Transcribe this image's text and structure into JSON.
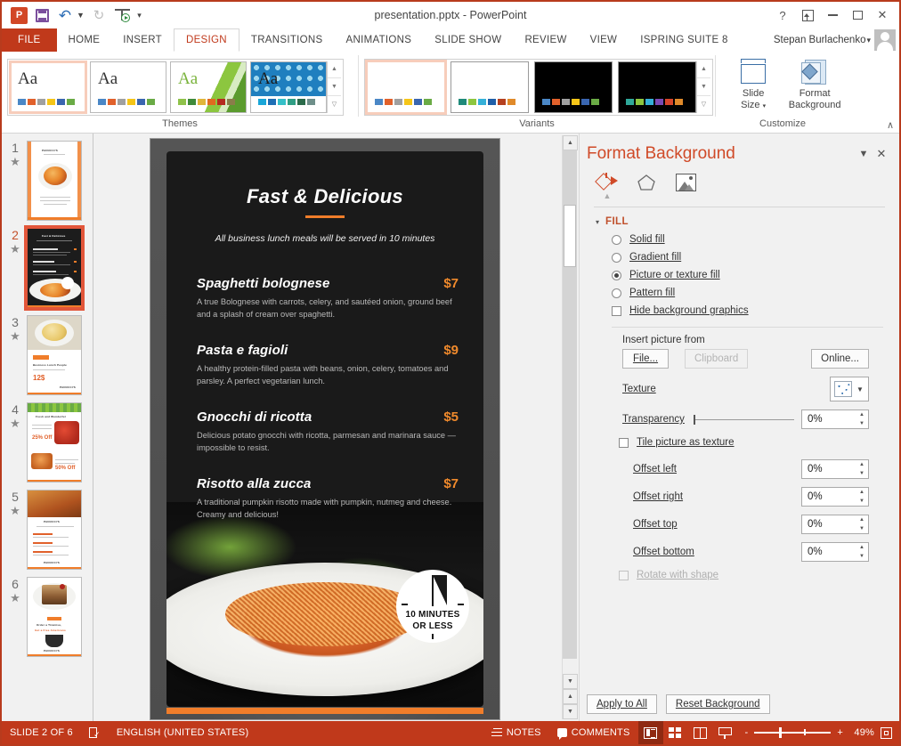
{
  "titlebar": {
    "document_title": "presentation.pptx - PowerPoint",
    "quick_access": [
      {
        "name": "powerpoint-logo",
        "label": "P"
      },
      {
        "name": "save",
        "label": "Save"
      },
      {
        "name": "undo",
        "label": "Undo"
      },
      {
        "name": "redo",
        "label": "Redo"
      },
      {
        "name": "start-slideshow",
        "label": "Start From Beginning"
      },
      {
        "name": "customize-qat",
        "label": "Customize Quick Access Toolbar"
      }
    ],
    "help_label": "?",
    "ribbon_display_label": "Ribbon Display Options",
    "minimize_label": "Minimize",
    "maximize_label": "Restore Down",
    "close_label": "✕"
  },
  "tabs": {
    "file": "FILE",
    "items": [
      "HOME",
      "INSERT",
      "DESIGN",
      "TRANSITIONS",
      "ANIMATIONS",
      "SLIDE SHOW",
      "REVIEW",
      "VIEW",
      "ISPRING SUITE 8"
    ],
    "active": "DESIGN",
    "user_name": "Stepan Burlachenko"
  },
  "ribbon": {
    "groups": [
      {
        "label": "Themes"
      },
      {
        "label": "Variants"
      },
      {
        "label": "Customize"
      }
    ],
    "themes": [
      {
        "name": "theme-office",
        "aa": "Aa",
        "selected": true,
        "swatches": [
          "#4a87c6",
          "#e1612b",
          "#a0a0a0",
          "#f5c518",
          "#3a66b0",
          "#6aab45"
        ]
      },
      {
        "name": "theme-plain",
        "aa": "Aa",
        "selected": false,
        "swatches": [
          "#4a87c6",
          "#e1612b",
          "#a0a0a0",
          "#f5c518",
          "#3a66b0",
          "#6aab45"
        ]
      },
      {
        "name": "theme-facet",
        "aa": "Aa",
        "selected": false,
        "swatches": [
          "#8fc24a",
          "#3f8a3a",
          "#e0b53a",
          "#e06a1f",
          "#b52a1f",
          "#8a7d4a"
        ]
      },
      {
        "name": "theme-ion-boardroom",
        "aa": "Aa",
        "selected": false,
        "swatches": [
          "#19a6d8",
          "#1f6fb5",
          "#35c0c8",
          "#2f9e84",
          "#2b6b4a",
          "#6e8f8a"
        ]
      }
    ],
    "variants": [
      {
        "name": "variant-1",
        "bg": "#ffffff",
        "selected": true,
        "swatches": [
          "#4a87c6",
          "#e1612b",
          "#a0a0a0",
          "#f5c518",
          "#3a66b0",
          "#6aab45"
        ]
      },
      {
        "name": "variant-2",
        "bg": "#ffffff",
        "selected": false,
        "swatches": [
          "#1f8a7a",
          "#8dc63f",
          "#35b0d8",
          "#1f5fa8",
          "#b5401f",
          "#e08a2a"
        ]
      },
      {
        "name": "variant-3",
        "bg": "#000000",
        "selected": false,
        "swatches": [
          "#4a87c6",
          "#e1612b",
          "#a0a0a0",
          "#f5c518",
          "#3a66b0",
          "#6aab45"
        ]
      },
      {
        "name": "variant-4",
        "bg": "#000000",
        "selected": false,
        "swatches": [
          "#2fa89a",
          "#8dc63f",
          "#35b0d8",
          "#7a4ab5",
          "#d8462b",
          "#e08a2a"
        ]
      }
    ],
    "customize": {
      "slide_size": "Slide\nSize",
      "slide_size_line1": "Slide",
      "slide_size_line2": "Size",
      "format_background_line1": "Format",
      "format_background_line2": "Background"
    },
    "collapse_label": "∧"
  },
  "thumbnails": [
    {
      "number": "1",
      "star": "★",
      "selected": false,
      "kind": "cover"
    },
    {
      "number": "2",
      "star": "★",
      "selected": true,
      "kind": "menu-dark"
    },
    {
      "number": "3",
      "star": "★",
      "selected": false,
      "kind": "price"
    },
    {
      "number": "4",
      "star": "★",
      "selected": false,
      "kind": "promo"
    },
    {
      "number": "5",
      "star": "★",
      "selected": false,
      "kind": "list"
    },
    {
      "number": "6",
      "star": "★",
      "selected": false,
      "kind": "dessert"
    }
  ],
  "slide": {
    "title": "Fast & Delicious",
    "subtitle": "All business lunch meals will be served in 10 minutes",
    "accent_color": "#f07d2a",
    "dishes": [
      {
        "name": "Spaghetti bolognese",
        "price": "$7",
        "description": "A true Bolognese with carrots, celery, and sautéed onion, ground beef and a splash of cream over spaghetti."
      },
      {
        "name": "Pasta e fagioli",
        "price": "$9",
        "description": "A healthy protein-filled pasta with beans, onion, celery, tomatoes and parsley. A perfect vegetarian lunch."
      },
      {
        "name": "Gnocchi di ricotta",
        "price": "$5",
        "description": "Delicious potato gnocchi with ricotta, parmesan and marinara sauce — impossible to resist."
      },
      {
        "name": "Risotto alla zucca",
        "price": "$7",
        "description": "A traditional pumpkin risotto made with pumpkin, nutmeg and cheese. Creamy and delicious!"
      }
    ],
    "badge_line1": "10 MINUTES",
    "badge_line2": "OR LESS"
  },
  "pane": {
    "title": "Format Background",
    "tabs": [
      {
        "name": "fill-tab",
        "label": "Fill",
        "selected": true
      },
      {
        "name": "effects-tab",
        "label": "Effects",
        "selected": false
      },
      {
        "name": "picture-tab",
        "label": "Picture",
        "selected": false
      }
    ],
    "section_label": "FILL",
    "fill_options": [
      {
        "label": "Solid fill",
        "selected": false
      },
      {
        "label": "Gradient fill",
        "selected": false
      },
      {
        "label": "Picture or texture fill",
        "selected": true
      },
      {
        "label": "Pattern fill",
        "selected": false
      }
    ],
    "hide_background_graphics": {
      "label": "Hide background graphics",
      "checked": false
    },
    "insert_picture_from": "Insert picture from",
    "buttons": {
      "file": "File...",
      "clipboard": "Clipboard",
      "clipboard_disabled": true,
      "online": "Online..."
    },
    "texture_label": "Texture",
    "transparency_label": "Transparency",
    "transparency_value": "0%",
    "tile_picture": {
      "label": "Tile picture as texture",
      "checked": false
    },
    "offsets": [
      {
        "label": "Offset left",
        "value": "0%"
      },
      {
        "label": "Offset right",
        "value": "0%"
      },
      {
        "label": "Offset top",
        "value": "0%"
      },
      {
        "label": "Offset bottom",
        "value": "0%"
      }
    ],
    "rotate_with_shape": {
      "label": "Rotate with shape",
      "checked": false,
      "disabled": true
    },
    "footer": {
      "apply_to_all": "Apply to All",
      "reset_background": "Reset Background"
    },
    "collapse_label": "▼",
    "close_label": "✕"
  },
  "statusbar": {
    "slide_indicator": "SLIDE 2 OF 6",
    "language": "ENGLISH (UNITED STATES)",
    "notes": "NOTES",
    "comments": "COMMENTS",
    "views": [
      {
        "name": "normal-view",
        "label": "Normal",
        "active": true
      },
      {
        "name": "slide-sorter-view",
        "label": "Slide Sorter",
        "active": false
      },
      {
        "name": "reading-view",
        "label": "Reading View",
        "active": false
      },
      {
        "name": "slide-show-view",
        "label": "Slide Show",
        "active": false
      }
    ],
    "zoom_out": "-",
    "zoom_in": "+",
    "zoom_level": "49%",
    "fit_slide_label": "Fit slide to current window"
  }
}
